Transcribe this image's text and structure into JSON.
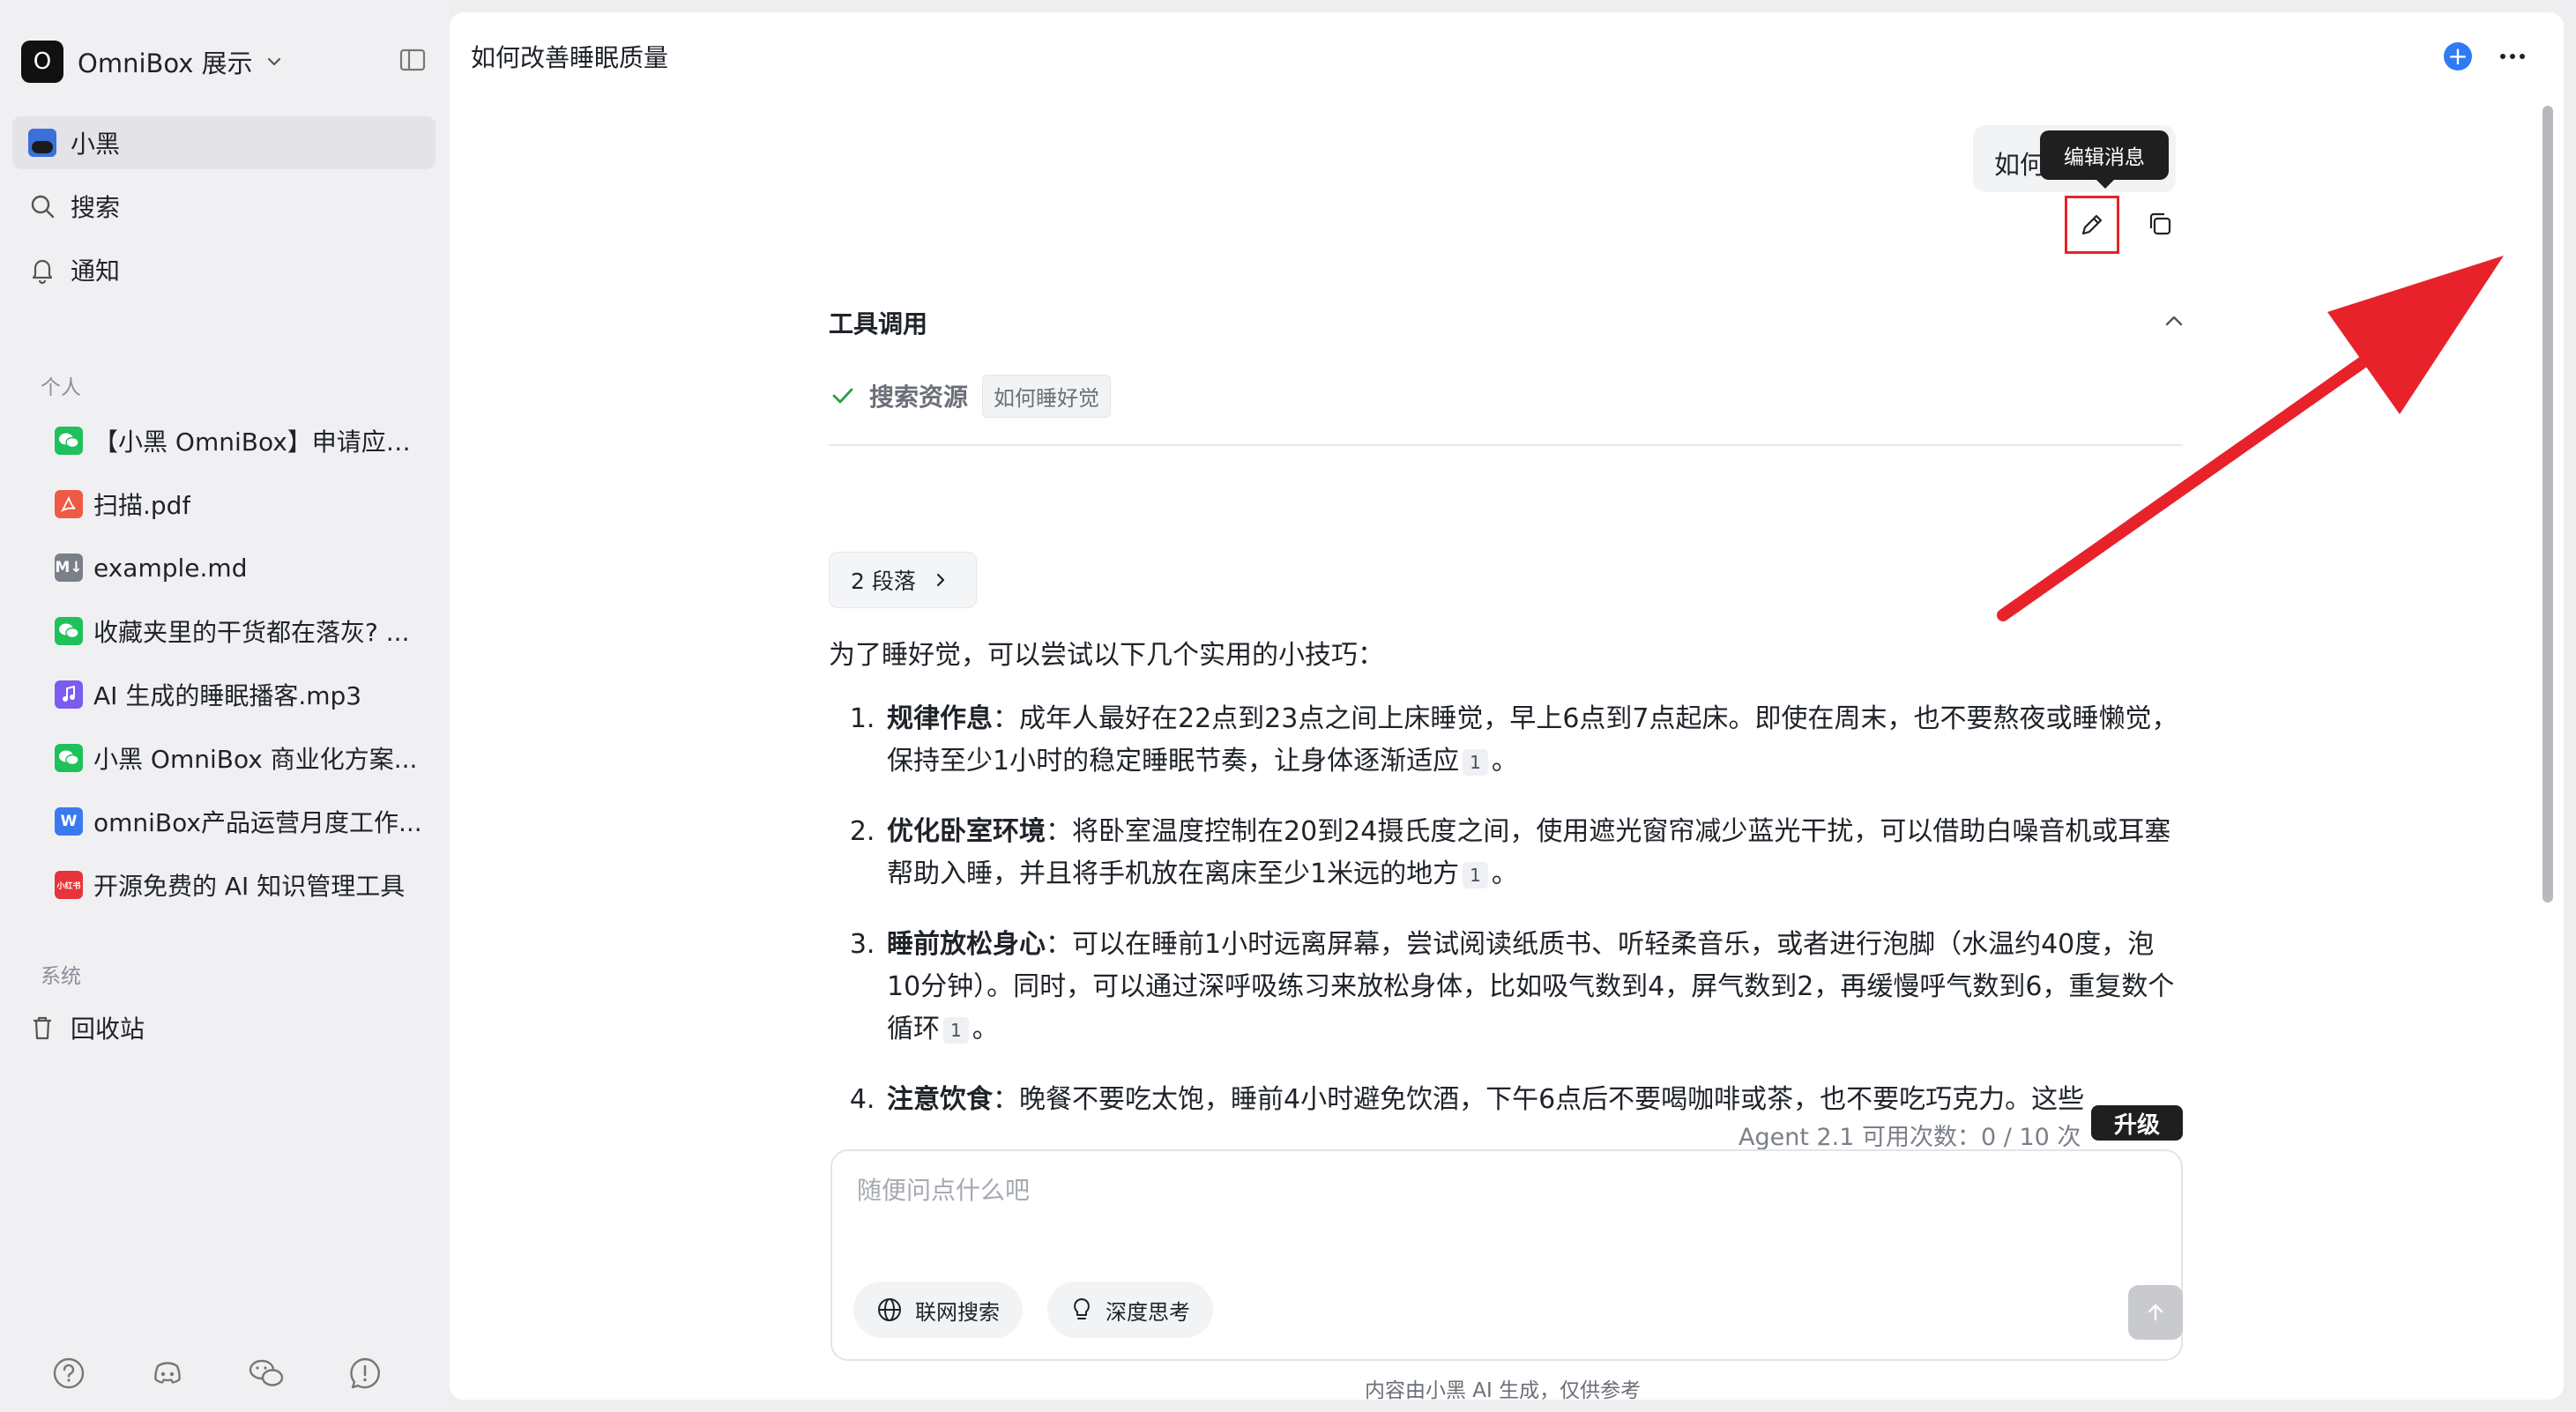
{
  "workspace": {
    "name": "OmniBox 展示",
    "initial": "O"
  },
  "nav": [
    {
      "label": "小黑",
      "icon": "avatar-icon",
      "active": true
    },
    {
      "label": "搜索",
      "icon": "search-icon"
    },
    {
      "label": "通知",
      "icon": "bell-icon"
    }
  ],
  "sections": {
    "personal": "个人",
    "system": "系统"
  },
  "files": [
    {
      "label": "【小黑 OmniBox】申请应聘...",
      "icon": "wechat-icon"
    },
    {
      "label": "扫描.pdf",
      "icon": "pdf-icon"
    },
    {
      "label": "example.md",
      "icon": "markdown-icon"
    },
    {
      "label": "收藏夹里的干货都在落灰? ...",
      "icon": "wechat-icon"
    },
    {
      "label": "AI 生成的睡眠播客.mp3",
      "icon": "audio-icon"
    },
    {
      "label": "小黑 OmniBox 商业化方案...",
      "icon": "wechat-icon"
    },
    {
      "label": "omniBox产品运营月度工作...",
      "icon": "word-icon"
    },
    {
      "label": "开源免费的 AI 知识管理工具",
      "icon": "xiaohongshu-icon"
    }
  ],
  "file_badges": {
    "md": "M↓",
    "word": "W",
    "red": "小红书"
  },
  "trash": {
    "label": "回收站"
  },
  "chat": {
    "title": "如何改善睡眠质量",
    "user_message": "如何",
    "tooltip": "编辑消息",
    "tools_title": "工具调用",
    "tool_name": "搜索资源",
    "tool_query": "如何睡好觉",
    "paragraph_btn": "2 段落",
    "intro": "为了睡好觉，可以尝试以下几个实用的小技巧：",
    "tips": [
      {
        "title": "规律作息",
        "sep": "：",
        "text": "成年人最好在22点到23点之间上床睡觉，早上6点到7点起床。即使在周末，也不要熬夜或睡懒觉，保持至少1小时的稳定睡眠节奏，让身体逐渐适应",
        "cite": "1",
        "end": "。"
      },
      {
        "title": "优化卧室环境",
        "sep": "：",
        "text": "将卧室温度控制在20到24摄氏度之间，使用遮光窗帘减少蓝光干扰，可以借助白噪音机或耳塞帮助入睡，并且将手机放在离床至少1米远的地方",
        "cite": "1",
        "end": "。"
      },
      {
        "title": "睡前放松身心",
        "sep": "：",
        "text": "可以在睡前1小时远离屏幕，尝试阅读纸质书、听轻柔音乐，或者进行泡脚（水温约40度，泡10分钟）。同时，可以通过深呼吸练习来放松身体，比如吸气数到4，屏气数到2，再缓慢呼气数到6，重复数个循环",
        "cite": "1",
        "end": "。"
      },
      {
        "title": "注意饮食",
        "sep": "：",
        "text": "晚餐不要吃太饱，睡前4小时避免饮酒，下午6点后不要喝咖啡或茶，也不要吃巧克力。这些",
        "cite": "",
        "end": ""
      }
    ]
  },
  "quota": {
    "text": "Agent 2.1 可用次数：0 / 10 次",
    "upgrade": "升级"
  },
  "composer": {
    "placeholder": "随便问点什么吧",
    "web_search": "联网搜索",
    "deep_think": "深度思考"
  },
  "disclaimer": "内容由小黑 AI 生成，仅供参考",
  "colors": {
    "accent": "#2f7bf5",
    "annotation": "#e8222a"
  }
}
